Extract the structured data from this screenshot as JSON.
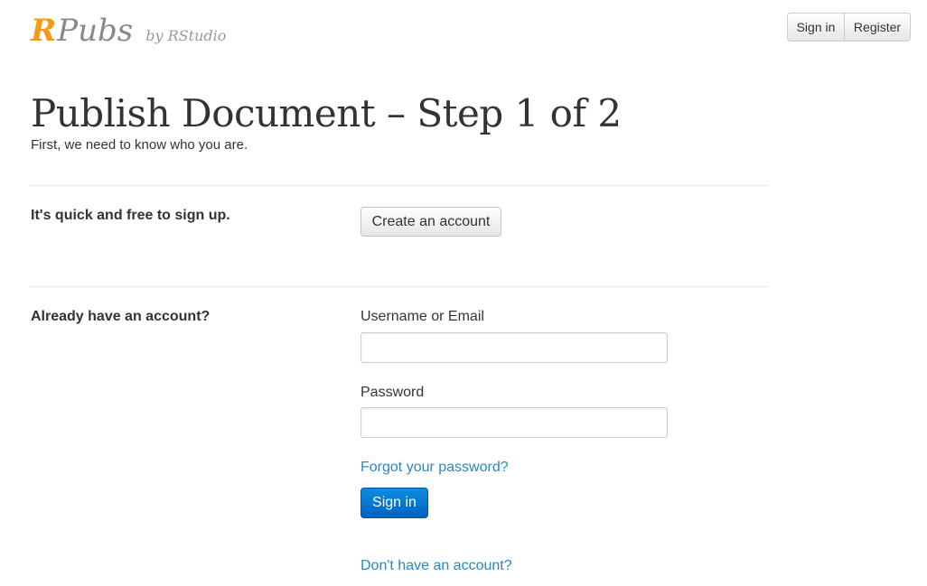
{
  "brand": {
    "logo_r": "R",
    "logo_rest": "Pubs",
    "byline": "by RStudio",
    "accent": "#f59b13"
  },
  "nav": {
    "sign_in": "Sign in",
    "register": "Register"
  },
  "page": {
    "title": "Publish Document – Step 1 of 2",
    "subtitle": "First, we need to know who you are."
  },
  "signup": {
    "label": "It's quick and free to sign up.",
    "button": "Create an account"
  },
  "login": {
    "label": "Already have an account?",
    "username_label": "Username or Email",
    "username_value": "",
    "password_label": "Password",
    "password_value": "",
    "forgot_link": "Forgot your password?",
    "submit": "Sign in",
    "no_account_link": "Don't have an account?"
  },
  "colors": {
    "link": "#2a88bd",
    "primary": "#0a7bd6"
  }
}
